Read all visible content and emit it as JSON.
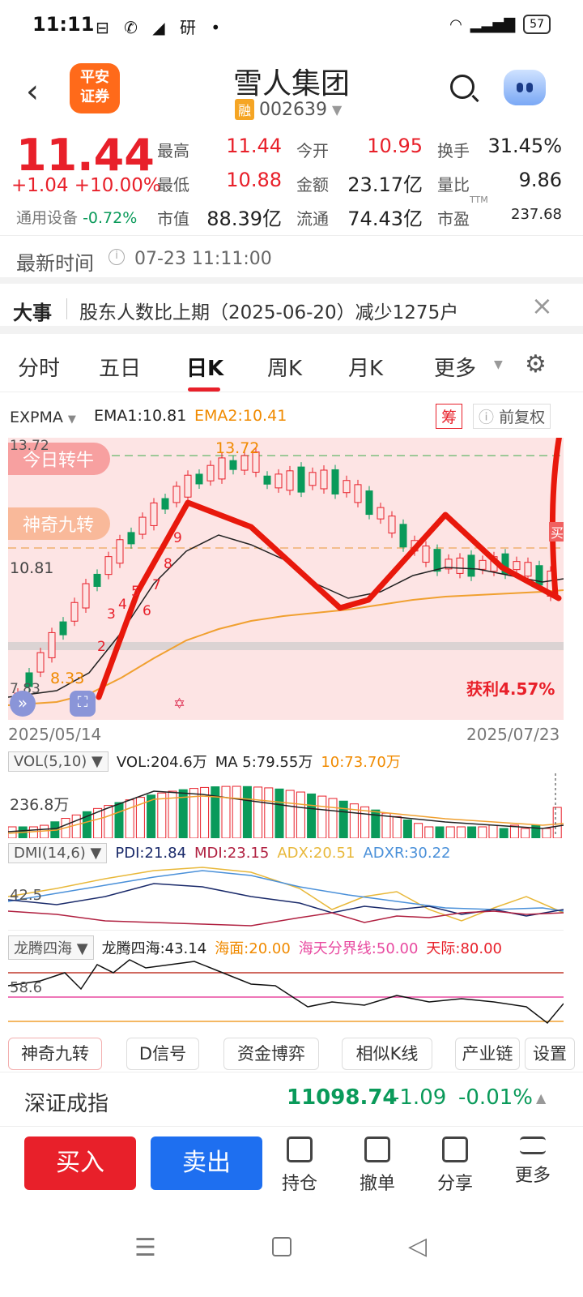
{
  "status": {
    "time": "11:11",
    "icons": "⊟ ✆ ◢ 研 •",
    "battery": "57"
  },
  "header": {
    "logo_line1": "平安",
    "logo_line2": "证券",
    "title": "雪人集团",
    "tag": "融",
    "code": "002639"
  },
  "quote": {
    "price": "11.44",
    "change": "+1.04",
    "change_pct": "+10.00%",
    "sector_name": "通用设备",
    "sector_pct": "-0.72%",
    "labels": [
      "最高",
      "今开",
      "换手",
      "最低",
      "金额",
      "量比",
      "市值",
      "流通",
      "市盈"
    ],
    "values": [
      "11.44",
      "10.95",
      "31.45%",
      "10.88",
      "23.17亿",
      "9.86",
      "88.39亿",
      "74.43亿",
      "237.68"
    ],
    "ttm": "TTM"
  },
  "timebar": {
    "label": "最新时间",
    "value": "07-23 11:11:00"
  },
  "news": {
    "label": "大事",
    "text": "股东人数比上期（2025-06-20）减少1275户"
  },
  "tabs": [
    "分时",
    "五日",
    "日K",
    "周K",
    "月K",
    "更多"
  ],
  "chart_bar": {
    "indicator": "EXPMA",
    "ema1": "EMA1:10.81",
    "ema2": "EMA2:10.41",
    "chou": "筹",
    "fuquan": "前复权"
  },
  "kchart": {
    "high_label": "13.72",
    "high_marker": "13.72",
    "mid_label": "10.81",
    "low_label": "7.83",
    "low_marker": "8.33",
    "pill1": "今日转牛",
    "pill2": "神奇九转",
    "profit": "获利4.57%",
    "buy_tag": "买",
    "start_date": "2025/05/14",
    "end_date": "2025/07/23",
    "nine_counts": [
      "2",
      "3",
      "4",
      "5",
      "6",
      "7",
      "8",
      "9"
    ]
  },
  "vol": {
    "selector": "VOL(5,10)",
    "vol": "VOL:204.6万",
    "ma5": "MA 5:79.55万",
    "ma10": "10:73.70万",
    "axis": "236.8万"
  },
  "dmi": {
    "selector": "DMI(14,6)",
    "pdi": "PDI:21.84",
    "mdi": "MDI:23.15",
    "adx": "ADX:20.51",
    "adxr": "ADXR:30.22",
    "axis": "42.5"
  },
  "ltsh": {
    "selector": "龙腾四海",
    "value": "龙腾四海:43.14",
    "sea": "海面:20.00",
    "line": "海天分界线:50.00",
    "sky": "天际:80.00",
    "axis": "58.6"
  },
  "feature_tabs": [
    "神奇九转",
    "D信号",
    "资金博弈",
    "相似K线",
    "产业链",
    "设置"
  ],
  "index": {
    "name": "深证成指",
    "value": "11098.74",
    "change": "-1.09",
    "pct": "-0.01%"
  },
  "actions": {
    "buy": "买入",
    "sell": "卖出",
    "hold": "持仓",
    "cancel": "撤单",
    "share": "分享",
    "more": "更多"
  }
}
